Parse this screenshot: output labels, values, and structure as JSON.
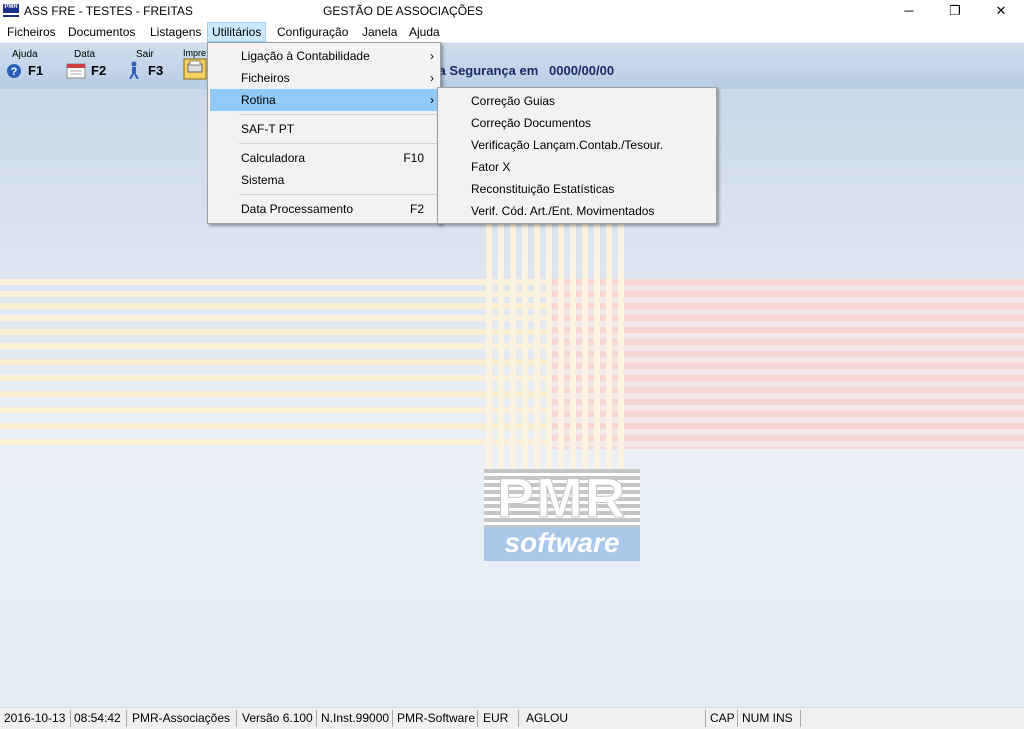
{
  "window": {
    "title": "ASS FRE - TESTES - FREITAS",
    "center_title": "GESTÃO DE ASSOCIAÇÕES",
    "icon_text": "PMR",
    "controls": {
      "minimize": "─",
      "restore": "❐",
      "close": "✕"
    }
  },
  "menubar": [
    {
      "label": "Ficheiros"
    },
    {
      "label": "Documentos"
    },
    {
      "label": "Listagens"
    },
    {
      "label": "Utilitários",
      "active": true
    },
    {
      "label": "Configuração"
    },
    {
      "label": "Janela"
    },
    {
      "label": "Ajuda"
    }
  ],
  "toolbar": {
    "buttons": [
      {
        "label": "Ajuda",
        "key": "F1",
        "icon": "help-icon"
      },
      {
        "label": "Data",
        "key": "F2",
        "icon": "calendar-icon"
      },
      {
        "label": "Sair",
        "key": "F3",
        "icon": "exit-icon"
      },
      {
        "label": "Impre",
        "key": "",
        "icon": "printer-icon"
      }
    ],
    "seguranca_text": "ma Segurança em",
    "seguranca_date": "0000/00/00"
  },
  "utilitarios_menu": {
    "items": [
      {
        "label": "Ligação à Contabilidade",
        "submenu": true
      },
      {
        "label": "Ficheiros",
        "submenu": true
      },
      {
        "label": "Rotina",
        "submenu": true,
        "highlighted": true
      },
      {
        "label": "SAF-T PT"
      },
      {
        "label": "Calculadora",
        "key": "F10"
      },
      {
        "label": "Sistema"
      },
      {
        "label": "Data Processamento",
        "key": "F2"
      }
    ]
  },
  "rotina_submenu": {
    "items": [
      {
        "label": "Correção Guias"
      },
      {
        "label": "Correção Documentos"
      },
      {
        "label": "Verificação Lançam.Contab./Tesour."
      },
      {
        "label": "Fator X"
      },
      {
        "label": "Reconstituição Estatísticas"
      },
      {
        "label": "Verif. Cód. Art./Ent. Movimentados"
      }
    ]
  },
  "logo": {
    "top": "PMR",
    "bottom": "software"
  },
  "statusbar": {
    "date": "2016-10-13",
    "time": "08:54:42",
    "app": "PMR-Associações",
    "version": "Versão  6.100",
    "inst": "N.Inst.99000",
    "company": "PMR-Software",
    "currency": "EUR",
    "user": "AGLOU",
    "cap": "CAP",
    "numins": "NUM INS"
  },
  "colors": {
    "menu_highlight": "#91c9f7",
    "menubar_active": "#cce8ff",
    "toolbar": "#c4d6ea",
    "logo_blue": "#a9c7e8"
  }
}
